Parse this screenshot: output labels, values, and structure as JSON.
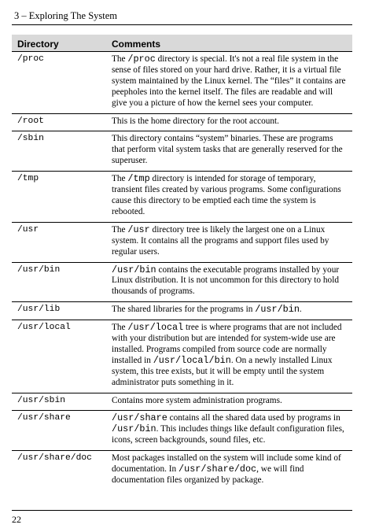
{
  "header": {
    "chapter": "3 – Exploring The System"
  },
  "table": {
    "columns": [
      "Directory",
      "Comments"
    ],
    "rows": [
      {
        "dir": "/proc",
        "segments": [
          {
            "t": "The "
          },
          {
            "t": "/proc",
            "code": true
          },
          {
            "t": " directory is special. It's not a real file system in the sense of files stored on your hard drive. Rather, it is a virtual file system maintained by the Linux kernel. The “files” it contains are peepholes into the kernel itself. The files are readable and will give you a picture of how the kernel sees your computer."
          }
        ]
      },
      {
        "dir": "/root",
        "segments": [
          {
            "t": "This is the home directory for the root account."
          }
        ]
      },
      {
        "dir": "/sbin",
        "segments": [
          {
            "t": "This directory contains “system” binaries. These are programs that perform vital system tasks that are generally reserved for the superuser."
          }
        ]
      },
      {
        "dir": "/tmp",
        "segments": [
          {
            "t": "The "
          },
          {
            "t": "/tmp",
            "code": true
          },
          {
            "t": " directory is intended for storage of temporary, transient files created by various programs. Some configurations cause this directory to be emptied each time the system is rebooted."
          }
        ]
      },
      {
        "dir": "/usr",
        "segments": [
          {
            "t": "The "
          },
          {
            "t": "/usr",
            "code": true
          },
          {
            "t": " directory tree is likely the largest one on a Linux system. It contains all the programs and support files used by regular users."
          }
        ]
      },
      {
        "dir": "/usr/bin",
        "segments": [
          {
            "t": "/usr/bin",
            "code": true
          },
          {
            "t": " contains the executable programs installed by your Linux distribution. It is not uncommon for this directory to hold thousands of programs."
          }
        ]
      },
      {
        "dir": "/usr/lib",
        "segments": [
          {
            "t": "The shared libraries for the programs in "
          },
          {
            "t": "/usr/bin",
            "code": true
          },
          {
            "t": "."
          }
        ]
      },
      {
        "dir": "/usr/local",
        "segments": [
          {
            "t": "The "
          },
          {
            "t": "/usr/local",
            "code": true
          },
          {
            "t": " tree is where programs that are not included with your distribution but are intended for system-wide use are installed. Programs compiled from source code are normally installed in "
          },
          {
            "t": "/usr/local/bin",
            "code": true
          },
          {
            "t": ". On a newly installed Linux system, this tree exists, but it will be empty until the system administrator puts something in it."
          }
        ]
      },
      {
        "dir": "/usr/sbin",
        "segments": [
          {
            "t": "Contains more system administration programs."
          }
        ]
      },
      {
        "dir": "/usr/share",
        "segments": [
          {
            "t": "/usr/share",
            "code": true
          },
          {
            "t": " contains all the shared data used by programs in "
          },
          {
            "t": "/usr/bin",
            "code": true
          },
          {
            "t": ". This includes things like default configuration files, icons, screen backgrounds, sound files, etc."
          }
        ]
      },
      {
        "dir": "/usr/share/doc",
        "segments": [
          {
            "t": "Most packages installed on the system will include some kind of documentation. In "
          },
          {
            "t": "/usr/share/doc",
            "code": true
          },
          {
            "t": ", we will find documentation files organized by package."
          }
        ]
      }
    ]
  },
  "footer": {
    "page_number": "22"
  }
}
